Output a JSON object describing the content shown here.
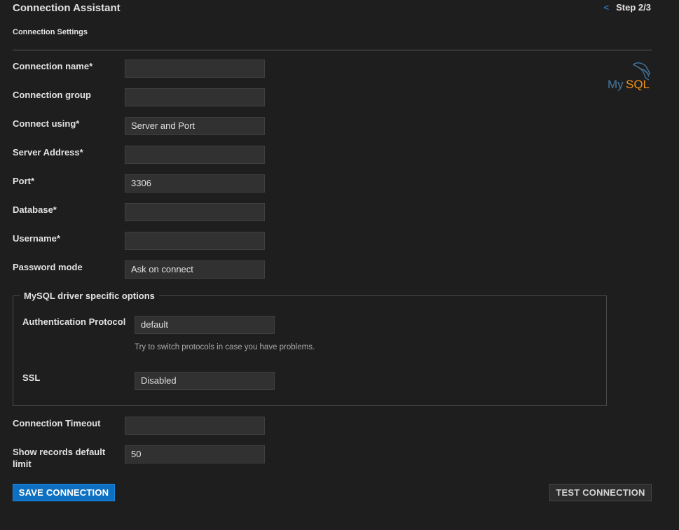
{
  "header": {
    "title": "Connection Assistant",
    "subtitle": "Connection Settings",
    "step": "Step 2/3",
    "back_glyph": "<"
  },
  "logo": {
    "text_my": "My",
    "text_sql": "SQL",
    "colors": {
      "my": "#4479a1",
      "sql": "#f29111",
      "dolphin": "#4479a1"
    }
  },
  "form": {
    "connection_name": {
      "label": "Connection name*",
      "value": ""
    },
    "connection_group": {
      "label": "Connection group",
      "value": ""
    },
    "connect_using": {
      "label": "Connect using*",
      "value": "Server and Port"
    },
    "server_address": {
      "label": "Server Address*",
      "value": ""
    },
    "port": {
      "label": "Port*",
      "value": "3306"
    },
    "database": {
      "label": "Database*",
      "value": ""
    },
    "username": {
      "label": "Username*",
      "value": ""
    },
    "password_mode": {
      "label": "Password mode",
      "value": "Ask on connect"
    }
  },
  "driver_options": {
    "legend": "MySQL driver specific options",
    "auth_protocol": {
      "label": "Authentication Protocol",
      "value": "default",
      "hint": "Try to switch protocols in case you have problems."
    },
    "ssl": {
      "label": "SSL",
      "value": "Disabled"
    }
  },
  "extra": {
    "connection_timeout": {
      "label": "Connection Timeout",
      "value": ""
    },
    "show_records_limit": {
      "label_line1": "Show records default",
      "label_line2": "limit",
      "value": "50"
    }
  },
  "actions": {
    "save_label": "SAVE CONNECTION",
    "test_label": "TEST CONNECTION"
  },
  "colors": {
    "background": "#1e1e1e",
    "input_bg": "#313131",
    "primary": "#0e70c0",
    "link": "#3794ff"
  }
}
